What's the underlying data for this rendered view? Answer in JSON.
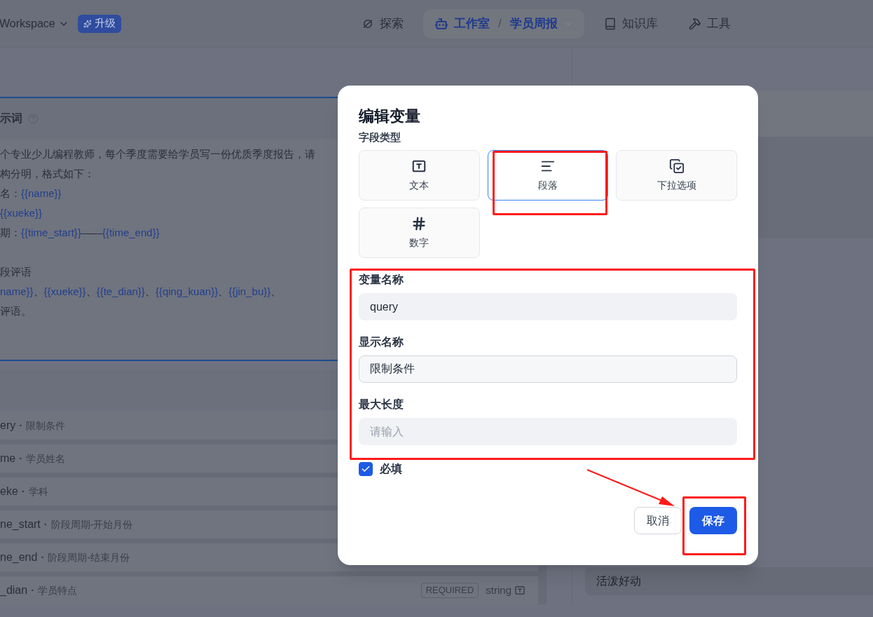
{
  "header": {
    "workspace": "Workspace",
    "upgrade": "升级",
    "nav": [
      {
        "kind": "explore",
        "label": "探索",
        "selected": false
      },
      {
        "kind": "studio",
        "label": "工作室",
        "separator": "/",
        "sub": "学员周报",
        "selected": true
      },
      {
        "kind": "knowledge",
        "label": "知识库",
        "selected": false
      },
      {
        "kind": "tools",
        "label": "工具",
        "selected": false
      }
    ]
  },
  "prompt": {
    "title": "示词",
    "lines": [
      {
        "segments": [
          {
            "text": "个专业少儿编程教师，每个季度需要给学员写一份优质季度报告，请",
            "var": false
          }
        ]
      },
      {
        "segments": [
          {
            "text": "构分明，格式如下：",
            "var": false
          }
        ]
      },
      {
        "segments": [
          {
            "text": "名：",
            "var": false
          },
          {
            "text": "{{name}}",
            "var": true
          }
        ]
      },
      {
        "segments": [
          {
            "text": "{{xueke}}",
            "var": true
          }
        ]
      },
      {
        "segments": [
          {
            "text": "期：",
            "var": false
          },
          {
            "text": "{{time_start}}",
            "var": true
          },
          {
            "text": "——",
            "var": false
          },
          {
            "text": "{{time_end}}",
            "var": true
          }
        ]
      },
      {
        "gap_before": true,
        "segments": [
          {
            "text": "段评语",
            "var": false
          }
        ]
      },
      {
        "segments": [
          {
            "text": "name}}",
            "var": true
          },
          {
            "text": "、",
            "var": false
          },
          {
            "text": "{{xueke}}",
            "var": true
          },
          {
            "text": "、",
            "var": false
          },
          {
            "text": "{{te_dian}}",
            "var": true
          },
          {
            "text": "、",
            "var": false
          },
          {
            "text": "{{qing_kuan}}",
            "var": true
          },
          {
            "text": "、",
            "var": false
          },
          {
            "text": "{{jin_bu}}",
            "var": true
          },
          {
            "text": "、",
            "var": false
          }
        ]
      },
      {
        "segments": [
          {
            "text": "评语。",
            "var": false
          }
        ]
      }
    ]
  },
  "variables": [
    {
      "name": "ery",
      "sep": "·",
      "display": "限制条件"
    },
    {
      "name": "me",
      "sep": "·",
      "display": "学员姓名"
    },
    {
      "name": "eke",
      "sep": "·",
      "display": "学科"
    },
    {
      "name": "ne_start",
      "sep": "·",
      "display": "阶段周期-开始月份"
    },
    {
      "name": "ne_end",
      "sep": "·",
      "display": "阶段周期-结束月份"
    },
    {
      "name": "_dian",
      "sep": "·",
      "display": "学员特点",
      "badge": "REQUIRED",
      "type": "string"
    }
  ],
  "side_field": {
    "value": "活泼好动"
  },
  "dialog": {
    "title": "编辑变量",
    "type_label": "字段类型",
    "types": [
      {
        "kind": "text",
        "label": "文本",
        "selected": false
      },
      {
        "kind": "paragraph",
        "label": "段落",
        "selected": true
      },
      {
        "kind": "select",
        "label": "下拉选项",
        "selected": false
      },
      {
        "kind": "number",
        "label": "数字",
        "selected": false
      }
    ],
    "fields": [
      {
        "label": "变量名称",
        "value": "query",
        "focused": false
      },
      {
        "label": "显示名称",
        "value": "限制条件",
        "focused": true
      },
      {
        "label": "最大长度",
        "placeholder": "请输入",
        "focused": false
      }
    ],
    "required": {
      "label": "必填",
      "checked": true
    },
    "buttons": [
      {
        "kind": "secondary",
        "label": "取消"
      },
      {
        "kind": "primary",
        "label": "保存"
      }
    ]
  }
}
